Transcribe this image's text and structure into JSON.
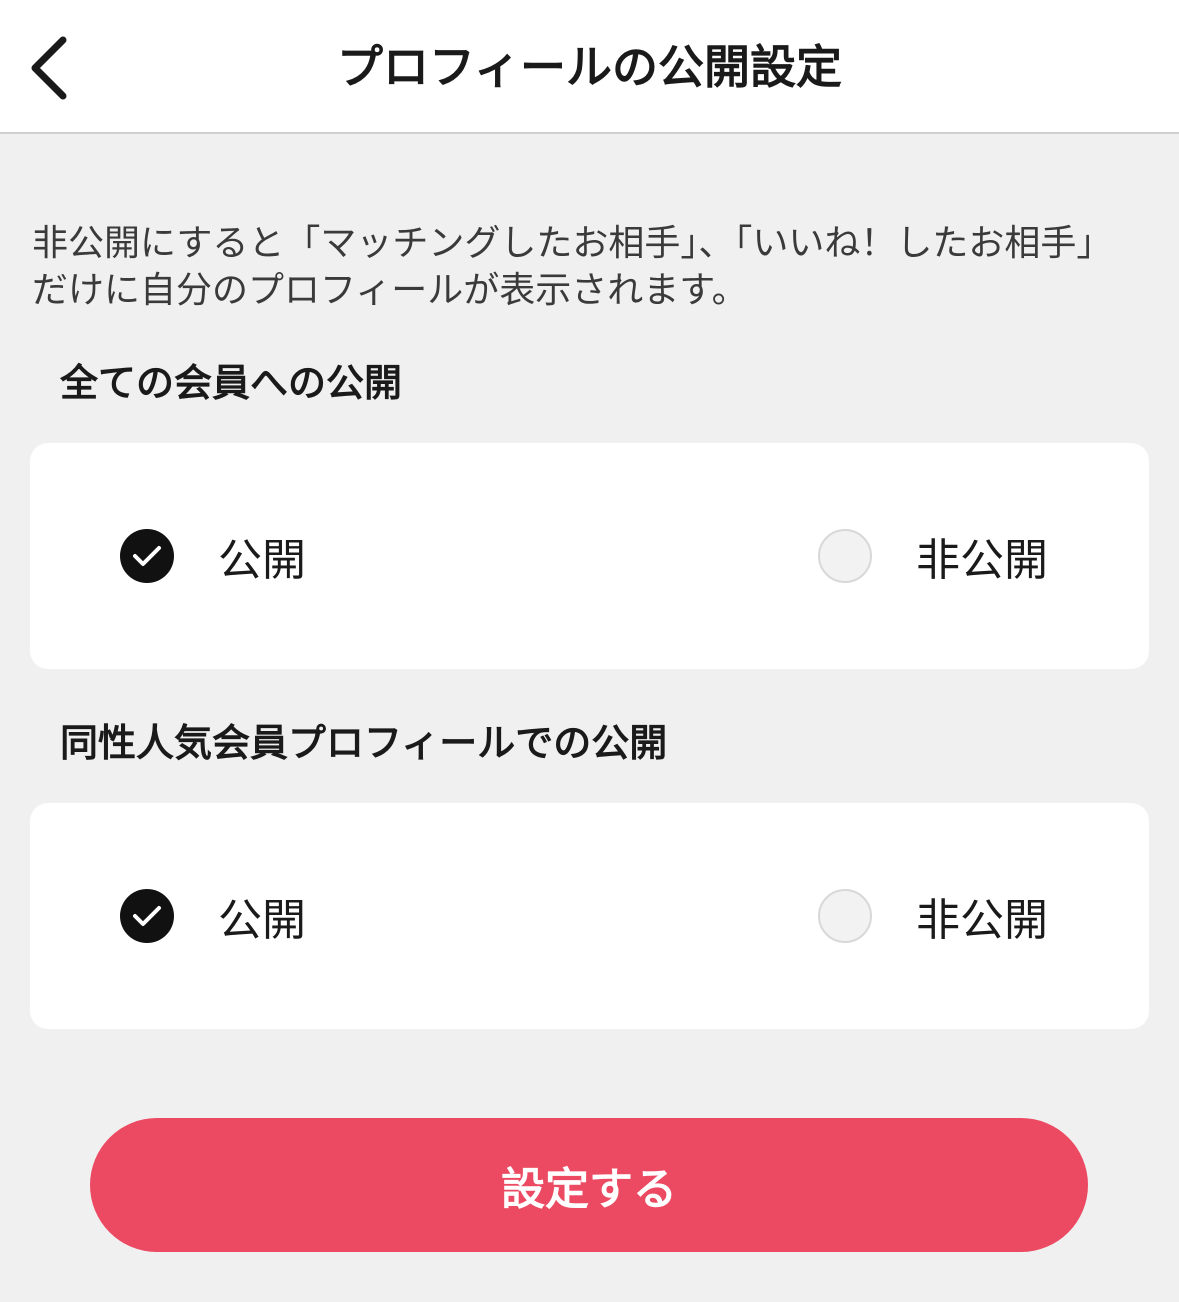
{
  "header": {
    "title": "プロフィールの公開設定",
    "back_icon": "chevron-left-icon"
  },
  "description": "非公開にすると「マッチングしたお相手」、「いいね！したお相手」だけに自分のプロフィールが表示されます。",
  "sections": [
    {
      "heading": "全ての会員への公開",
      "options": [
        {
          "label": "公開",
          "selected": true
        },
        {
          "label": "非公開",
          "selected": false
        }
      ]
    },
    {
      "heading": "同性人気会員プロフィールでの公開",
      "options": [
        {
          "label": "公開",
          "selected": true
        },
        {
          "label": "非公開",
          "selected": false
        }
      ]
    }
  ],
  "submit": {
    "label": "設定する"
  },
  "colors": {
    "accent": "#ec4a62",
    "checked": "#111111",
    "background": "#f0f0f0",
    "card": "#ffffff"
  }
}
